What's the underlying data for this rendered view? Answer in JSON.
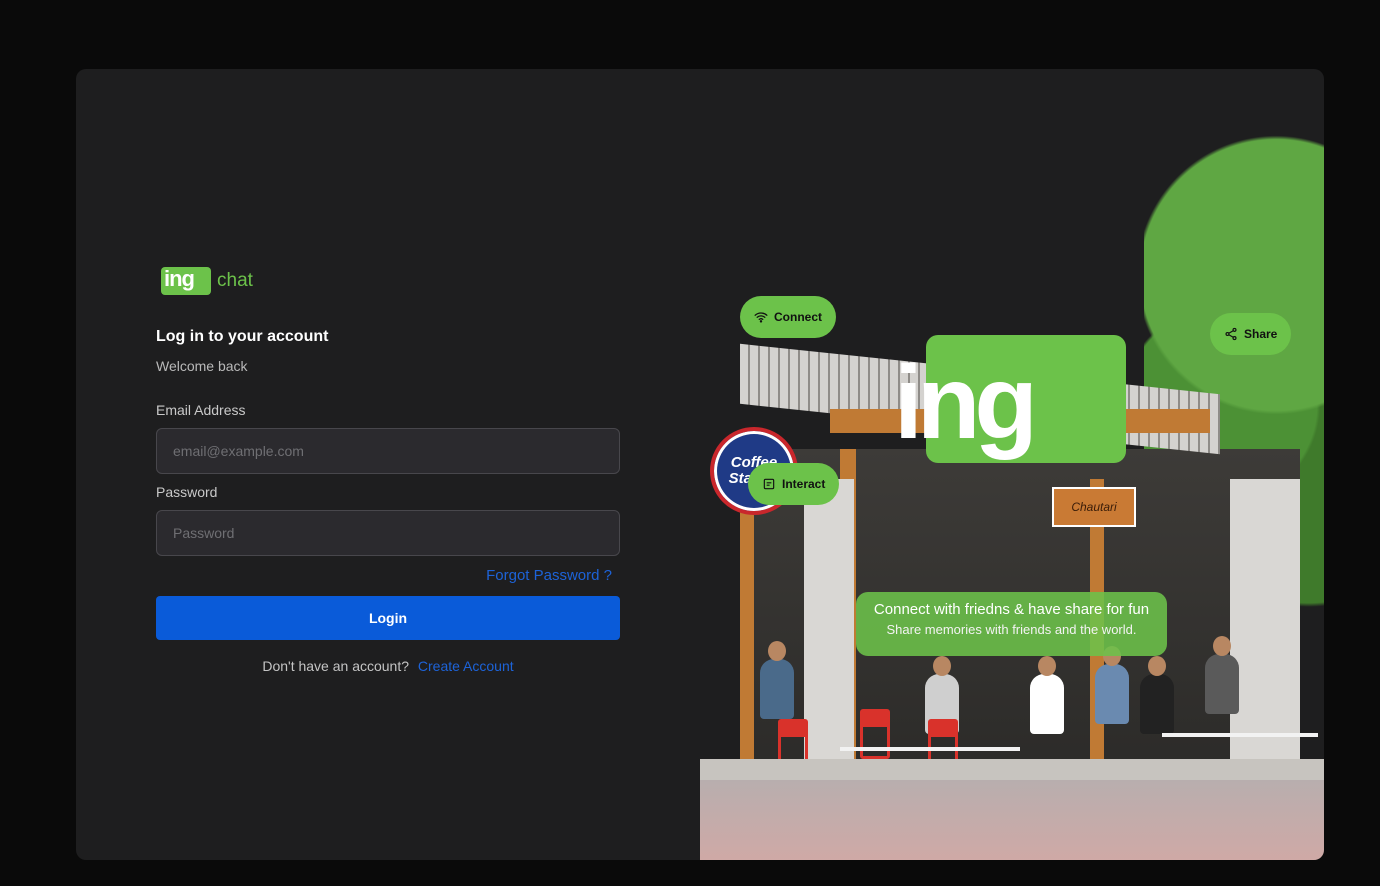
{
  "brand": {
    "logo_mark": "ing",
    "logo_text": "chat",
    "accent": "#6cc24a",
    "link_color": "#1d63d8",
    "button_color": "#0a5bd9"
  },
  "form": {
    "title": "Log in to your account",
    "subtitle": "Welcome back",
    "email_label": "Email Address",
    "email_placeholder": "email@example.com",
    "email_value": "",
    "password_label": "Password",
    "password_placeholder": "Password",
    "password_value": "",
    "forgot_label": "Forgot Password ?",
    "login_label": "Login",
    "signup_prompt": "Don't have an account?",
    "signup_link": "Create Account"
  },
  "hero": {
    "big_logo": "ing",
    "pills": [
      {
        "label": "Connect",
        "icon": "wifi-icon"
      },
      {
        "label": "Interact",
        "icon": "chat-box-icon"
      },
      {
        "label": "Share",
        "icon": "share-icon"
      }
    ],
    "banner_title": "Connect with friedns & have share for fun",
    "banner_subtitle": "Share memories with friends and the world.",
    "signs": {
      "round": "Coffee Station",
      "board": "Chautari"
    }
  }
}
